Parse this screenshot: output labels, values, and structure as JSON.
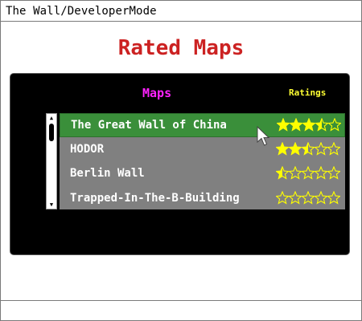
{
  "window": {
    "title": "The Wall/DeveloperMode"
  },
  "page": {
    "heading": "Rated Maps"
  },
  "table": {
    "maps_header": "Maps",
    "ratings_header": "Ratings",
    "max_stars": 5,
    "rows": [
      {
        "name": "The Great Wall of China",
        "rating": 3.5,
        "selected": true
      },
      {
        "name": "HODOR",
        "rating": 2.5,
        "selected": false
      },
      {
        "name": "Berlin Wall",
        "rating": 0.5,
        "selected": false
      },
      {
        "name": "Trapped-In-The-B-Building",
        "rating": 0,
        "selected": false
      }
    ]
  },
  "colors": {
    "heading": "#cc2222",
    "maps_header": "#ff22ff",
    "ratings_header": "#ffff33",
    "selected_row": "#3a8f3a",
    "row_bg": "#808080",
    "star": "#ffff00"
  },
  "icons": {
    "scroll_up": "scroll-up-arrow-icon",
    "scroll_down": "scroll-down-arrow-icon",
    "cursor": "mouse-pointer-icon",
    "star": "star-icon"
  }
}
